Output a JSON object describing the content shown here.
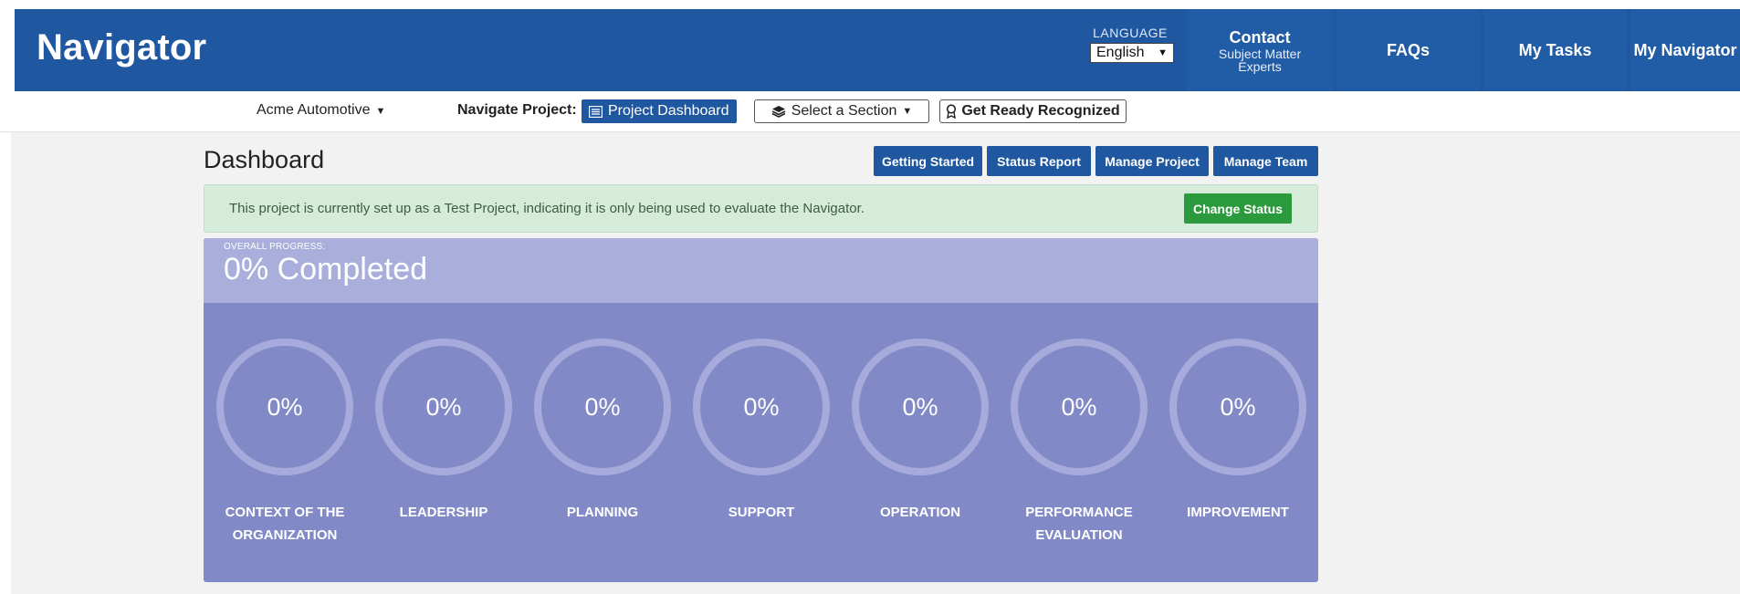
{
  "header": {
    "brand": "Navigator",
    "language_label": "LANGUAGE",
    "language_value": "English",
    "contact_title": "Contact",
    "contact_sub1": "Subject Matter",
    "contact_sub2": "Experts",
    "faqs": "FAQs",
    "my_tasks": "My Tasks",
    "my_navigator": "My Navigator"
  },
  "subnav": {
    "organization": "Acme Automotive",
    "navigate_label": "Navigate Project:",
    "project_dashboard": "Project Dashboard",
    "select_section": "Select a Section",
    "get_ready": "Get Ready Recognized"
  },
  "dashboard": {
    "title": "Dashboard",
    "buttons": {
      "getting_started": "Getting Started",
      "status_report": "Status Report",
      "manage_project": "Manage Project",
      "manage_team": "Manage Team"
    },
    "alert_text": "This project is currently set up as a Test Project, indicating it is only being used to evaluate the Navigator.",
    "change_status": "Change Status",
    "overall_label": "OVERALL PROGRESS:",
    "overall_value": "0% Completed",
    "sections": [
      {
        "pct": "0%",
        "line1": "CONTEXT OF THE",
        "line2": "ORGANIZATION"
      },
      {
        "pct": "0%",
        "line1": "LEADERSHIP",
        "line2": ""
      },
      {
        "pct": "0%",
        "line1": "PLANNING",
        "line2": ""
      },
      {
        "pct": "0%",
        "line1": "SUPPORT",
        "line2": ""
      },
      {
        "pct": "0%",
        "line1": "OPERATION",
        "line2": ""
      },
      {
        "pct": "0%",
        "line1": "PERFORMANCE",
        "line2": "EVALUATION"
      },
      {
        "pct": "0%",
        "line1": "IMPROVEMENT",
        "line2": ""
      }
    ]
  },
  "colors": {
    "brand_blue": "#1f57a1",
    "panel": "#8289c7",
    "alert_bg": "#d4ecd9",
    "success": "#2b9a3d"
  }
}
